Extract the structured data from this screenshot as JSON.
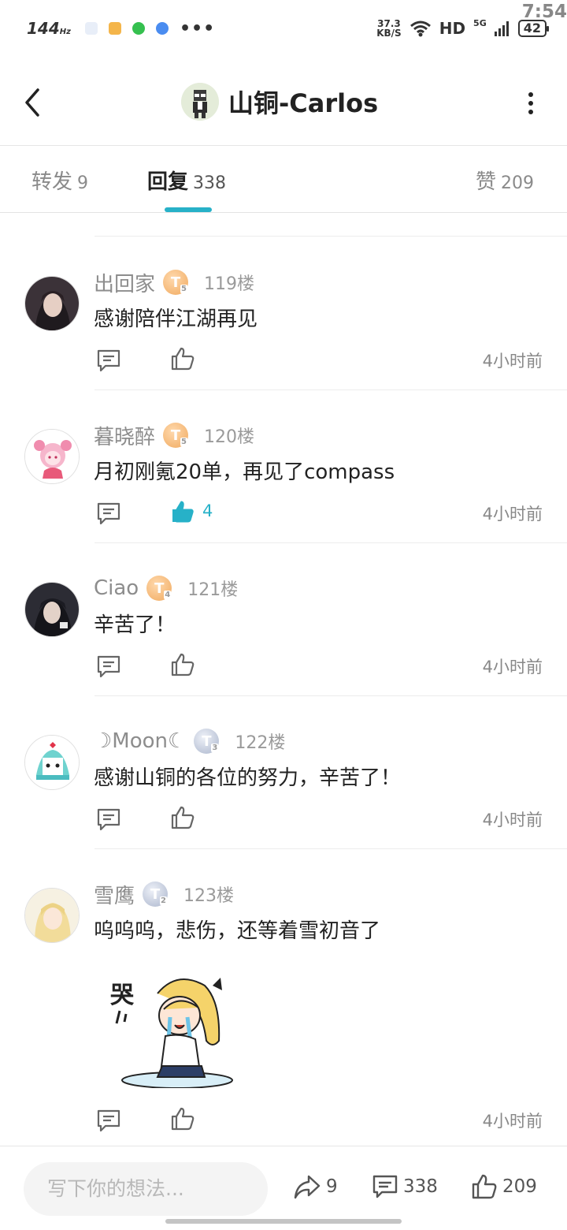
{
  "status_bar": {
    "time": "7:54",
    "refresh_rate": "144",
    "refresh_unit": "Hz",
    "more": "•••",
    "net_speed_value": "37.3",
    "net_speed_unit": "KB/S",
    "hd": "HD",
    "network": "5G",
    "battery": "42"
  },
  "header": {
    "title": "山铜-Carlos"
  },
  "tabs": [
    {
      "label": "转发",
      "count": "9",
      "active": false
    },
    {
      "label": "回复",
      "count": "338",
      "active": true
    },
    {
      "label": "赞",
      "count": "209",
      "active": false
    }
  ],
  "comments": [
    {
      "user": "出回家",
      "level": "T",
      "level_sub": "5",
      "level_tier": "gold",
      "floor": "119楼",
      "text": "感谢陪伴江湖再见",
      "likes": "",
      "liked": false,
      "time": "4小时前"
    },
    {
      "user": "暮晓醉",
      "level": "T",
      "level_sub": "5",
      "level_tier": "gold",
      "floor": "120楼",
      "text": "月初刚氪20单，再见了compass",
      "likes": "4",
      "liked": true,
      "time": "4小时前"
    },
    {
      "user": "Ciao",
      "level": "T",
      "level_sub": "4",
      "level_tier": "gold",
      "floor": "121楼",
      "text": "辛苦了！",
      "likes": "",
      "liked": false,
      "time": "4小时前"
    },
    {
      "user": "☽Moon☾",
      "level": "T",
      "level_sub": "3",
      "level_tier": "silver",
      "floor": "122楼",
      "text": "感谢山铜的各位的努力，辛苦了！",
      "likes": "",
      "liked": false,
      "time": "4小时前"
    },
    {
      "user": "雪鹰",
      "level": "T",
      "level_sub": "2",
      "level_tier": "silver",
      "floor": "123楼",
      "text": "呜呜呜，悲伤，还等着雪初音了",
      "likes": "",
      "liked": false,
      "time": "4小时前"
    }
  ],
  "bottom_bar": {
    "placeholder": "写下你的想法...",
    "repost_count": "9",
    "reply_count": "338",
    "like_count": "209"
  },
  "colors": {
    "accent": "#27b1c8",
    "secondary_text": "#8d8d8d",
    "divider": "#ececec"
  }
}
